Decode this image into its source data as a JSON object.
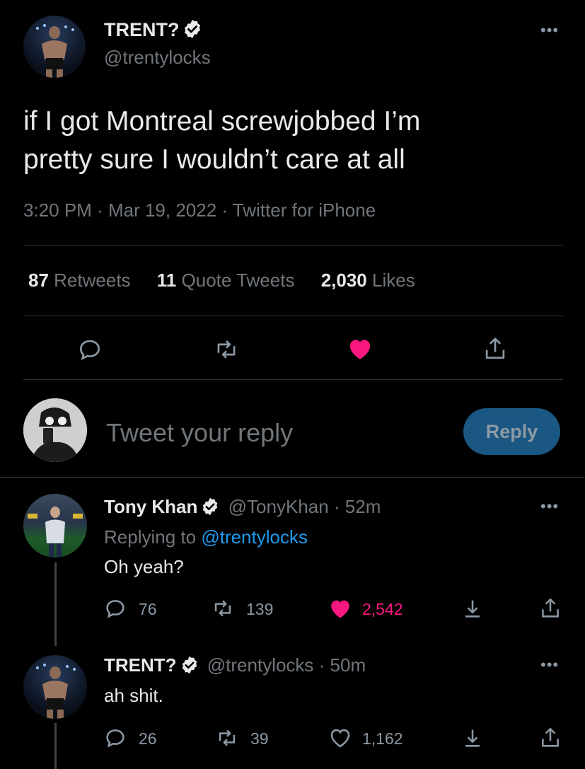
{
  "main_tweet": {
    "author_name": "TRENT?",
    "handle": "@trentylocks",
    "text_line1": "if I got Montreal screwjobbed I’m",
    "text_line2": "pretty sure I wouldn’t care at all",
    "time": "3:20 PM",
    "date": "Mar 19, 2022",
    "source": "Twitter for iPhone",
    "separator": "·"
  },
  "stats": {
    "retweets_count": "87",
    "retweets_label": "Retweets",
    "quotes_count": "11",
    "quotes_label": "Quote Tweets",
    "likes_count": "2,030",
    "likes_label": "Likes"
  },
  "reply_box": {
    "placeholder": "Tweet your reply",
    "button_label": "Reply"
  },
  "replies": [
    {
      "author_name": "Tony Khan",
      "handle": "@TonyKhan",
      "time": "· 52m",
      "replying_prefix": "Replying to",
      "replying_to": "@trentylocks",
      "text": "Oh yeah?",
      "comments": "76",
      "retweets": "139",
      "likes": "2,542",
      "liked": true
    },
    {
      "author_name": "TRENT?",
      "handle": "@trentylocks",
      "time": "· 50m",
      "text": "ah shit.",
      "comments": "26",
      "retweets": "39",
      "likes": "1,162",
      "liked": false
    }
  ],
  "colors": {
    "background": "#000000",
    "text": "#e7e9ea",
    "secondary": "#71767b",
    "link": "#1d9bf0",
    "like": "#f91880",
    "reply_button": "#1a5782",
    "divider": "#2f3336"
  }
}
